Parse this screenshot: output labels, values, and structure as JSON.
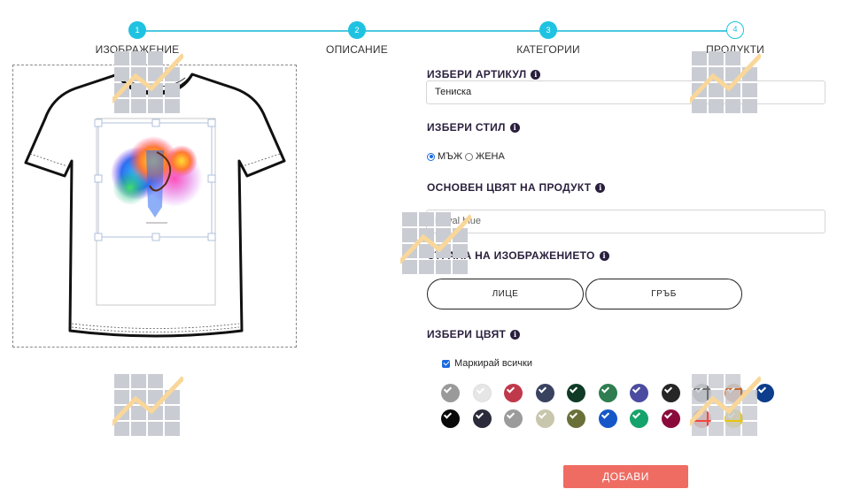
{
  "stepper": {
    "steps": [
      {
        "number": "1",
        "label": "ИЗОБРАЖЕНИЕ"
      },
      {
        "number": "2",
        "label": "ОПИСАНИЕ"
      },
      {
        "number": "3",
        "label": "КАТЕГОРИИ"
      },
      {
        "number": "4",
        "label": "ПРОДУКТИ"
      }
    ]
  },
  "form": {
    "article_label": "ИЗБЕРИ АРТИКУЛ",
    "article_value": "Тениска",
    "style_label": "ИЗБЕРИ СТИЛ",
    "style_options": [
      "МЪЖ",
      "ЖЕНА"
    ],
    "base_color_label": "ОСНОВЕН ЦВЯТ НА ПРОДУКТ",
    "base_color_value": "Royal blue",
    "side_label": "СТРАНА НА ИЗОБРАЖЕНИЕТО",
    "side_front": "ЛИЦЕ",
    "side_back": "ГРЪБ",
    "color_label": "ИЗБЕРИ ЦВЯТ",
    "mark_all": "Маркирай всички",
    "add_button": "ДОБАВИ"
  },
  "colors": {
    "accent": "#1fc3e1",
    "add_button": "#ef6c63",
    "swatches_row1": [
      "#9a9a9a",
      "#e6e6e6",
      "#c0394b",
      "#39425e",
      "#0f3b26",
      "#2f7d50",
      "#4b4ba1",
      "#262626",
      "#6f6f6f",
      "#c46a35",
      "#0d3d8c"
    ],
    "swatches_row2": [
      "#0a0a0a",
      "#2b2b3b",
      "#9b9b9b",
      "#c8c7ad",
      "#6b7039",
      "#1557c8",
      "#14a36a",
      "#8b0a3c",
      "#f0463d",
      "#e8c413"
    ]
  },
  "icons": {
    "info": "info-icon",
    "placeholder": "image-placeholder-icon",
    "tshirt": "tshirt-outline"
  }
}
